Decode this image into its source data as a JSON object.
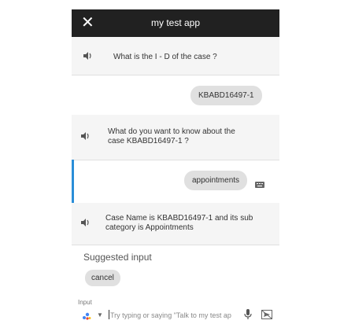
{
  "app": {
    "title": "my test app",
    "close_icon": "close-icon"
  },
  "conversation": {
    "bot_message_1": "What is the I - D of the case ?",
    "user_reply_1": "KBABD16497-1",
    "bot_message_2": "What do you want to know about the case KBABD16497-1 ?",
    "user_reply_2": "appointments",
    "bot_message_3": "Case Name is KBABD16497-1 and its sub category is Appointments"
  },
  "suggestions": {
    "label": "Suggested input",
    "chips": [
      "cancel"
    ]
  },
  "input": {
    "label": "Input",
    "placeholder": "Try typing or saying \"Talk to my test ap"
  },
  "colors": {
    "titlebar": "#212121",
    "accent": "#2a8ed8",
    "bubble": "#e0e0e0",
    "panel": "#f5f5f5"
  }
}
